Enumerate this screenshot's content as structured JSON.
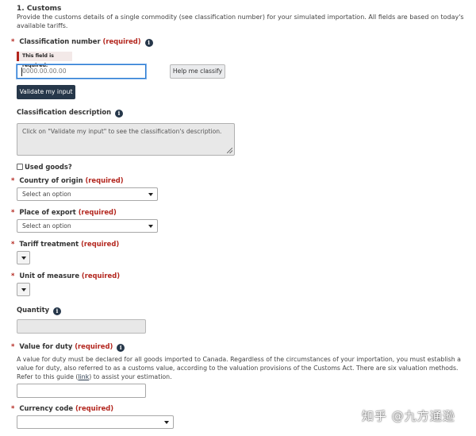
{
  "section": {
    "title": "1. Customs",
    "intro": "Provide the customs details of a single commodity (see classification number) for your simulated importation. All fields are based on today's available tariffs."
  },
  "required_star": "*",
  "required_text": "(required)",
  "info_glyph": "i",
  "classification": {
    "label": "Classification number",
    "error": "This field is required.",
    "placeholder": "0000.00.00.00",
    "help_button": "Help me classify",
    "validate_button": "Validate my input"
  },
  "description": {
    "label": "Classification description",
    "text": "Click on \"Validate my input\" to see the classification's description."
  },
  "used_goods": {
    "label": "Used goods?"
  },
  "country_of_origin": {
    "label": "Country of origin",
    "value": "Select an option"
  },
  "place_of_export": {
    "label": "Place of export",
    "value": "Select an option"
  },
  "tariff_treatment": {
    "label": "Tariff treatment"
  },
  "unit_of_measure": {
    "label": "Unit of measure"
  },
  "quantity": {
    "label": "Quantity"
  },
  "value_for_duty": {
    "label": "Value for duty",
    "help_before": "A value for duty must be declared for all goods imported to Canada. Regardless of the circumstances of your importation, you must establish a value for duty, also referred to as a customs value, according to the valuation provisions of the Customs Act. There are six valuation methods. Refer to this guide (",
    "help_link": "link",
    "help_after": ") to assist your estimation."
  },
  "currency_code": {
    "label": "Currency code"
  },
  "watermark": "知乎 @九方通逊"
}
